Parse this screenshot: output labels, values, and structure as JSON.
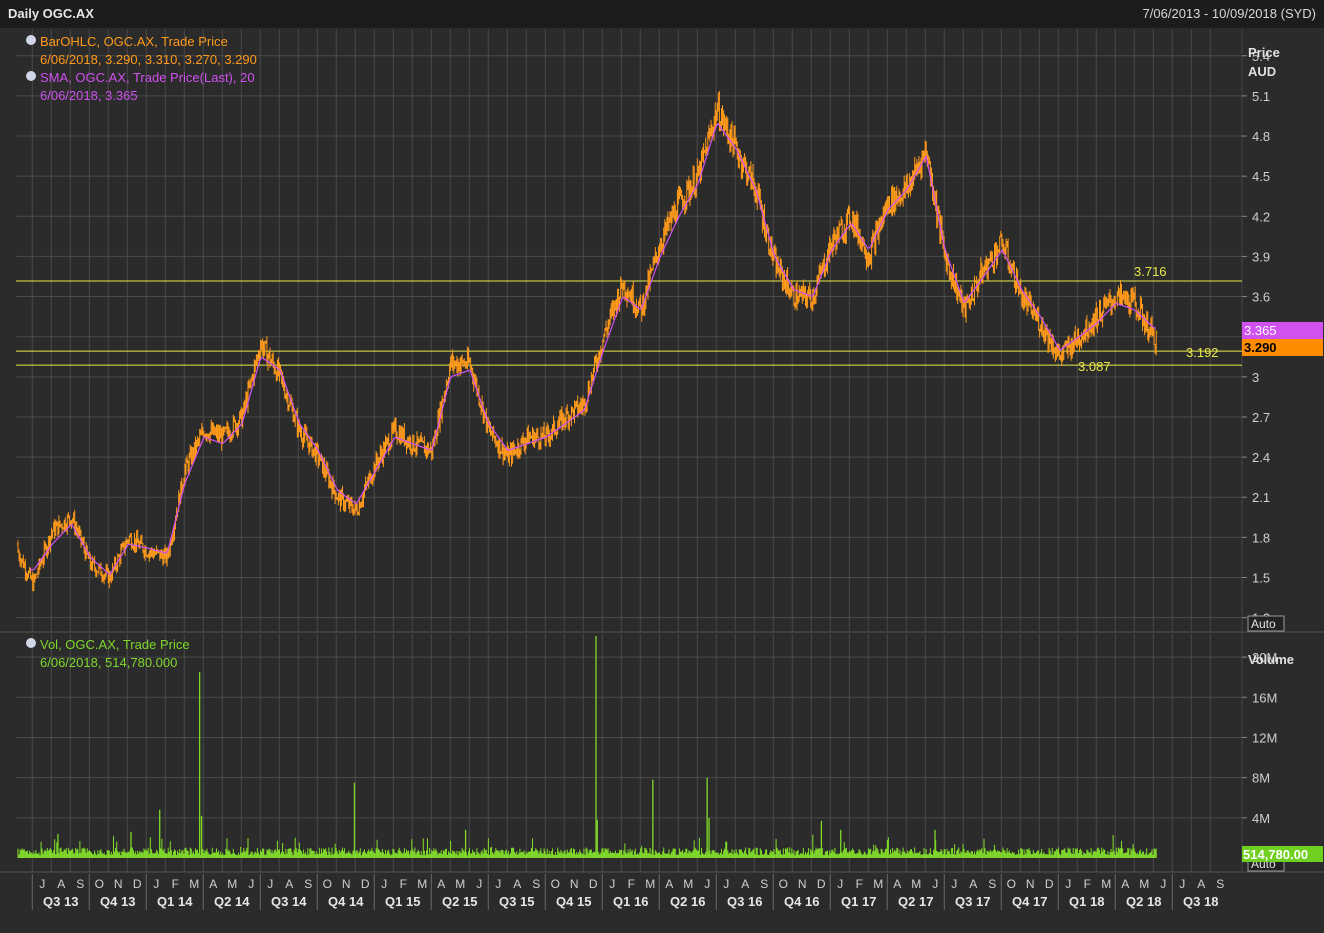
{
  "window": {
    "title": "Daily OGC.AX",
    "date_range": "7/06/2013 - 10/09/2018 (SYD)"
  },
  "price_panel": {
    "axis_title": "Price",
    "axis_unit": "AUD",
    "auto_label": "Auto",
    "legend": [
      {
        "line1": "BarOHLC, OGC.AX, Trade Price",
        "line2": "6/06/2018, 3.290, 3.310, 3.270, 3.290",
        "color": "#ff9a1a"
      },
      {
        "line1": "SMA, OGC.AX, Trade Price(Last),  20",
        "line2": "6/06/2018, 3.365",
        "color": "#d050f0"
      }
    ],
    "last_price_tag": "3.290",
    "last_sma_tag": "3.365",
    "hlines": [
      {
        "value": 3.716,
        "label": "3.716"
      },
      {
        "value": 3.192,
        "label": "3.192"
      },
      {
        "value": 3.087,
        "label": "3.087"
      }
    ]
  },
  "volume_panel": {
    "axis_title": "Volume",
    "auto_label": "Auto",
    "legend": {
      "line1": "Vol, OGC.AX, Trade Price",
      "line2": "6/06/2018, 514,780.000",
      "color": "#7fd82a"
    },
    "last_tag": "514,780.00"
  },
  "x_axis": {
    "months": [
      "J",
      "A",
      "S",
      "O",
      "N",
      "D",
      "J",
      "F",
      "M",
      "A",
      "M",
      "J",
      "J",
      "A",
      "S",
      "O",
      "N",
      "D",
      "J",
      "F",
      "M",
      "A",
      "M",
      "J",
      "J",
      "A",
      "S",
      "O",
      "N",
      "D",
      "J",
      "F",
      "M",
      "A",
      "M",
      "J",
      "J",
      "A",
      "S",
      "O",
      "N",
      "D",
      "J",
      "F",
      "M",
      "A",
      "M",
      "J",
      "J",
      "A",
      "S",
      "O",
      "N",
      "D",
      "J",
      "F",
      "M",
      "A",
      "M",
      "J",
      "J",
      "A",
      "S"
    ],
    "quarters": [
      "Q3 13",
      "Q4 13",
      "Q1 14",
      "Q2 14",
      "Q3 14",
      "Q4 14",
      "Q1 15",
      "Q2 15",
      "Q3 15",
      "Q4 15",
      "Q1 16",
      "Q2 16",
      "Q3 16",
      "Q4 16",
      "Q1 17",
      "Q2 17",
      "Q3 17",
      "Q4 17",
      "Q1 18",
      "Q2 18",
      "Q3 18"
    ]
  },
  "colors": {
    "bars": "#ff9a1a",
    "sma": "#d050f0",
    "volume": "#7fd82a",
    "hline": "#e8e84a",
    "grid": "#4a4a4a",
    "background": "#2b2b2b"
  },
  "chart_data": [
    {
      "type": "ohlc",
      "title": "Daily OGC.AX",
      "ylabel": "Price AUD",
      "ylim": [
        1.1,
        5.6
      ],
      "yticks": [
        1.2,
        1.5,
        1.8,
        2.1,
        2.4,
        2.7,
        3,
        3.3,
        3.6,
        3.9,
        4.2,
        4.5,
        4.8,
        5.1,
        5.4
      ],
      "x_start": "2013-06-07",
      "x_end": "2018-06-06",
      "grid": true,
      "legend_position": "top-left",
      "series": [
        {
          "name": "BarOHLC, OGC.AX, Trade Price",
          "type": "ohlc",
          "x": [
            "2013-06",
            "2013-07",
            "2013-08",
            "2013-09",
            "2013-10",
            "2013-11",
            "2013-12",
            "2014-01",
            "2014-02",
            "2014-03",
            "2014-04",
            "2014-05",
            "2014-06",
            "2014-07",
            "2014-08",
            "2014-09",
            "2014-10",
            "2014-11",
            "2014-12",
            "2015-01",
            "2015-02",
            "2015-03",
            "2015-04",
            "2015-05",
            "2015-06",
            "2015-07",
            "2015-08",
            "2015-09",
            "2015-10",
            "2015-11",
            "2015-12",
            "2016-01",
            "2016-02",
            "2016-03",
            "2016-04",
            "2016-05",
            "2016-06",
            "2016-07",
            "2016-08",
            "2016-09",
            "2016-10",
            "2016-11",
            "2016-12",
            "2017-01",
            "2017-02",
            "2017-03",
            "2017-04",
            "2017-05",
            "2017-06",
            "2017-07",
            "2017-08",
            "2017-09",
            "2017-10",
            "2017-11",
            "2017-12",
            "2018-01",
            "2018-02",
            "2018-03",
            "2018-04",
            "2018-05",
            "2018-06"
          ],
          "values": [
            1.75,
            1.45,
            1.85,
            1.95,
            1.6,
            1.5,
            1.8,
            1.7,
            1.65,
            2.3,
            2.6,
            2.55,
            2.7,
            3.25,
            3.0,
            2.6,
            2.4,
            2.1,
            2.0,
            2.35,
            2.6,
            2.5,
            2.45,
            3.1,
            3.1,
            2.6,
            2.4,
            2.55,
            2.55,
            2.7,
            2.8,
            3.3,
            3.7,
            3.5,
            4.0,
            4.3,
            4.5,
            5.0,
            4.7,
            4.4,
            3.85,
            3.6,
            3.6,
            4.0,
            4.2,
            3.9,
            4.3,
            4.4,
            4.7,
            3.9,
            3.5,
            3.8,
            4.0,
            3.6,
            3.4,
            3.15,
            3.3,
            3.45,
            3.6,
            3.55,
            3.29
          ]
        },
        {
          "name": "SMA, OGC.AX, Trade Price(Last), 20",
          "type": "line",
          "x": [
            "2013-06",
            "2013-07",
            "2013-08",
            "2013-09",
            "2013-10",
            "2013-11",
            "2013-12",
            "2014-01",
            "2014-02",
            "2014-03",
            "2014-04",
            "2014-05",
            "2014-06",
            "2014-07",
            "2014-08",
            "2014-09",
            "2014-10",
            "2014-11",
            "2014-12",
            "2015-01",
            "2015-02",
            "2015-03",
            "2015-04",
            "2015-05",
            "2015-06",
            "2015-07",
            "2015-08",
            "2015-09",
            "2015-10",
            "2015-11",
            "2015-12",
            "2016-01",
            "2016-02",
            "2016-03",
            "2016-04",
            "2016-05",
            "2016-06",
            "2016-07",
            "2016-08",
            "2016-09",
            "2016-10",
            "2016-11",
            "2016-12",
            "2017-01",
            "2017-02",
            "2017-03",
            "2017-04",
            "2017-05",
            "2017-06",
            "2017-07",
            "2017-08",
            "2017-09",
            "2017-10",
            "2017-11",
            "2017-12",
            "2018-01",
            "2018-02",
            "2018-03",
            "2018-04",
            "2018-05",
            "2018-06"
          ],
          "values": [
            1.65,
            1.55,
            1.75,
            1.9,
            1.65,
            1.52,
            1.75,
            1.72,
            1.68,
            2.2,
            2.55,
            2.5,
            2.65,
            3.15,
            3.05,
            2.65,
            2.45,
            2.15,
            2.05,
            2.3,
            2.55,
            2.5,
            2.45,
            3.0,
            3.05,
            2.65,
            2.45,
            2.5,
            2.55,
            2.65,
            2.75,
            3.2,
            3.6,
            3.5,
            3.9,
            4.2,
            4.45,
            4.9,
            4.7,
            4.4,
            3.9,
            3.65,
            3.6,
            3.95,
            4.15,
            3.95,
            4.25,
            4.4,
            4.65,
            3.95,
            3.55,
            3.75,
            3.95,
            3.65,
            3.45,
            3.2,
            3.3,
            3.4,
            3.55,
            3.5,
            3.365
          ]
        }
      ]
    },
    {
      "type": "bar",
      "title": "",
      "ylabel": "Volume",
      "ylim": [
        0,
        21500000
      ],
      "yticks": [
        4000000,
        8000000,
        12000000,
        16000000,
        20000000
      ],
      "ytick_labels": [
        "4M",
        "8M",
        "12M",
        "16M",
        "20M"
      ],
      "baseline_volume": 700000,
      "series": [
        {
          "name": "Vol, OGC.AX, Trade Price",
          "spikes": [
            {
              "date": "2013-08-10",
              "value": 2400000
            },
            {
              "date": "2013-12-05",
              "value": 2600000
            },
            {
              "date": "2014-01-20",
              "value": 4800000
            },
            {
              "date": "2014-03-25",
              "value": 18500000
            },
            {
              "date": "2014-03-28",
              "value": 4200000
            },
            {
              "date": "2014-11-28",
              "value": 7500000
            },
            {
              "date": "2015-05-25",
              "value": 2800000
            },
            {
              "date": "2015-12-20",
              "value": 23000000
            },
            {
              "date": "2015-12-22",
              "value": 3800000
            },
            {
              "date": "2016-03-20",
              "value": 7800000
            },
            {
              "date": "2016-06-15",
              "value": 8000000
            },
            {
              "date": "2016-06-18",
              "value": 4000000
            },
            {
              "date": "2016-12-15",
              "value": 3700000
            },
            {
              "date": "2017-01-15",
              "value": 2800000
            },
            {
              "date": "2017-06-15",
              "value": 2800000
            }
          ]
        }
      ]
    }
  ]
}
